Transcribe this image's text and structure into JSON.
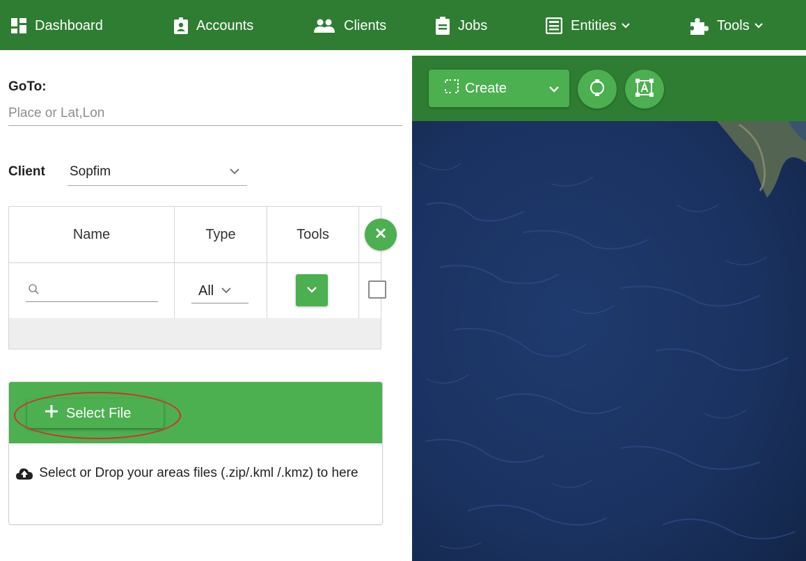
{
  "colors": {
    "nav_bg": "#2e7d32",
    "accent": "#4caf50",
    "highlight": "#d32f2f",
    "ocean": "#1d3566"
  },
  "nav": {
    "items": [
      {
        "label": "Dashboard",
        "icon": "dashboard-icon"
      },
      {
        "label": "Accounts",
        "icon": "id-badge-icon"
      },
      {
        "label": "Clients",
        "icon": "users-icon"
      },
      {
        "label": "Jobs",
        "icon": "clipboard-icon"
      },
      {
        "label": "Entities",
        "icon": "newspaper-icon"
      },
      {
        "label": "Tools",
        "icon": "puzzle-icon"
      }
    ]
  },
  "goto": {
    "label": "GoTo:",
    "placeholder": "Place or Lat,Lon"
  },
  "client": {
    "label": "Client",
    "value": "Sopfim"
  },
  "areas_table": {
    "columns": [
      "Name",
      "Type",
      "Tools"
    ],
    "type_filter_value": "All"
  },
  "upload": {
    "button_label": "Select File",
    "hint": "Select or Drop your areas files (.zip/.kml /.kmz) to here"
  },
  "map_toolbar": {
    "create_label": "Create"
  }
}
